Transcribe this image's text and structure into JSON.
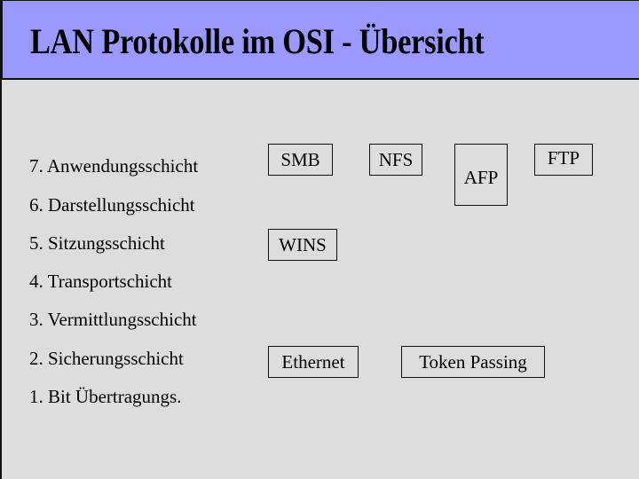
{
  "slide": {
    "title": "LAN Protokolle im OSI - Übersicht",
    "colors": {
      "header_bg": "#9999ff",
      "body_bg": "#dddddd",
      "border": "#111111"
    }
  },
  "layers": [
    {
      "label": "7. Anwendungsschicht"
    },
    {
      "label": "6. Darstellungsschicht"
    },
    {
      "label": "5. Sitzungsschicht"
    },
    {
      "label": "4. Transportschicht"
    },
    {
      "label": "3. Vermittlungsschicht"
    },
    {
      "label": "2. Sicherungsschicht"
    },
    {
      "label": "1. Bit Übertragungs."
    }
  ],
  "protocols": {
    "smb": "SMB",
    "nfs": "NFS",
    "afp": "AFP",
    "ftp": "FTP",
    "wins": "WINS",
    "ethernet": "Ethernet",
    "token_passing": "Token Passing"
  }
}
